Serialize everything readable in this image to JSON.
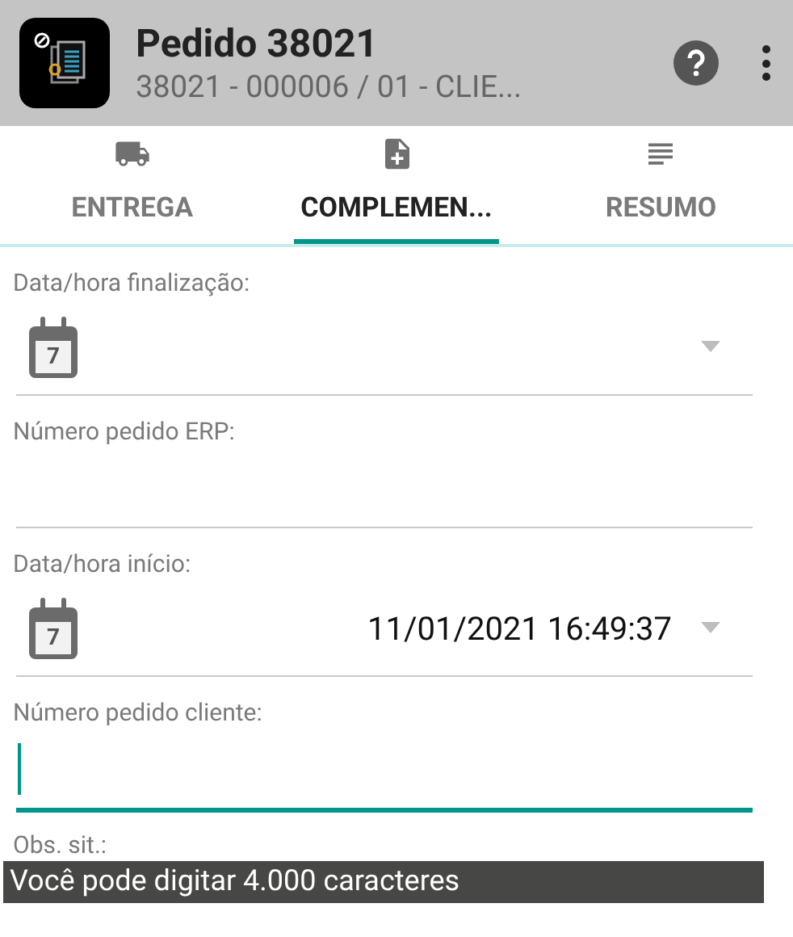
{
  "header": {
    "title": "Pedido 38021",
    "subtitle": "38021 - 000006 / 01 - CLIE..."
  },
  "tabs": [
    {
      "label": "ENTREGA",
      "selected": false
    },
    {
      "label": "COMPLEMEN...",
      "selected": true
    },
    {
      "label": "RESUMO",
      "selected": false
    }
  ],
  "fields": [
    {
      "kind": "date",
      "label": "Data/hora finalização:",
      "calendar_day": "7"
    },
    {
      "kind": "text",
      "label": "Número pedido ERP:",
      "focused": false
    },
    {
      "kind": "date",
      "label": "Data/hora início:",
      "calendar_day": "7",
      "value": "11/01/2021 16:49:37"
    },
    {
      "kind": "text",
      "label": "Número pedido cliente:",
      "focused": true
    }
  ],
  "obs": {
    "label": "Obs. sit.:",
    "hint": "Você pode digitar 4.000 caracteres"
  }
}
